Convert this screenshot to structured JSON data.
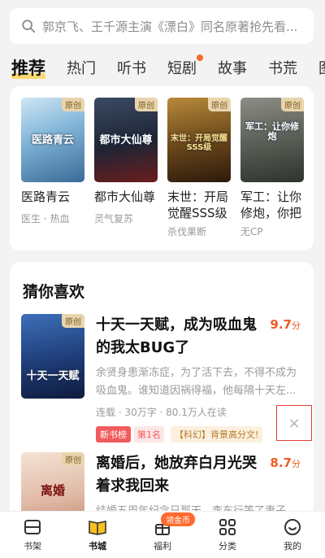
{
  "search": {
    "placeholder": "郭京飞、王千源主演《漂白》同名原著抢先看..."
  },
  "tabs": [
    {
      "label": "推荐",
      "active": true
    },
    {
      "label": "热门"
    },
    {
      "label": "听书"
    },
    {
      "label": "短剧",
      "has_dot": true
    },
    {
      "label": "故事"
    },
    {
      "label": "书荒"
    },
    {
      "label": "图:"
    }
  ],
  "top_books": [
    {
      "badge": "原创",
      "cover_text": "医路青云",
      "title": "医路青云",
      "tags": "医生 · 热血"
    },
    {
      "badge": "原创",
      "cover_text": "都市大仙尊",
      "title": "都市大仙尊",
      "tags": "灵气复苏"
    },
    {
      "badge": "原创",
      "cover_text": "末世：开局觉醒SSS级",
      "title": "末世：开局觉醒SSS级",
      "tags": "杀伐果断"
    },
    {
      "badge": "原创",
      "cover_text": "军工：让你修炮",
      "title": "军工：让你修炮，你把",
      "tags": "无CP"
    }
  ],
  "guess": {
    "title": "猜你喜欢",
    "items": [
      {
        "badge": "原创",
        "cover_text": "十天一天赋",
        "title": "十天一天赋，成为吸血鬼的我太BUG了",
        "score": "9.7",
        "score_unit": "分",
        "desc": "余贤身患渐冻症，为了活下去，不得不成为吸血鬼。谁知道因祸得福，他每隔十天左...",
        "meta": "连载 · 30万字 · 80.1万人在读",
        "tag_red": "新书榜",
        "tag_rank": "第1名",
        "tag_genre": "【科幻】背景高分文!"
      },
      {
        "badge": "原创",
        "cover_text": "离婚",
        "title": "离婚后，她放弃白月光哭着求我回来",
        "score": "8.7",
        "score_unit": "分",
        "desc": "结婚五周年纪念日那天，李东行等了妻子"
      }
    ]
  },
  "dismiss_icon": "×",
  "nav": [
    {
      "label": "书架",
      "icon": "bookshelf-icon"
    },
    {
      "label": "书城",
      "icon": "book-open-icon",
      "active": true
    },
    {
      "label": "福利",
      "icon": "gift-icon",
      "pill": "领金币"
    },
    {
      "label": "分类",
      "icon": "grid-icon"
    },
    {
      "label": "我的",
      "icon": "smile-icon"
    }
  ]
}
